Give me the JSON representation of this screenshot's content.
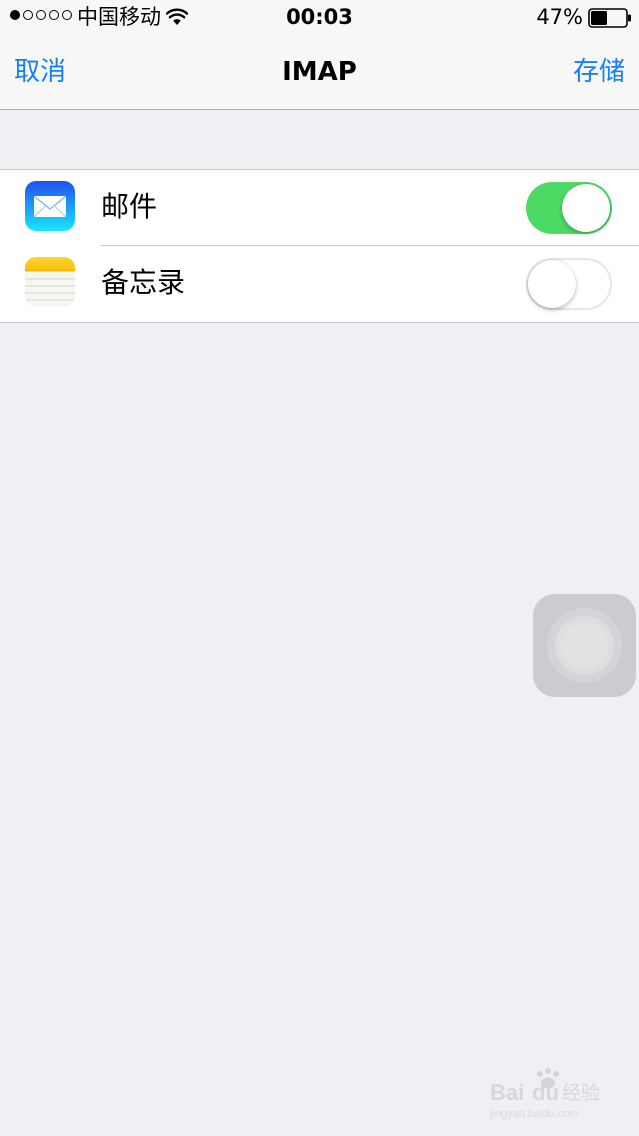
{
  "status_bar": {
    "carrier": "中国移动",
    "time": "00:03",
    "battery_percent": "47%",
    "battery_level": 0.47,
    "signal_bars_filled": 1,
    "signal_bars_total": 5
  },
  "nav": {
    "cancel_label": "取消",
    "title": "IMAP",
    "save_label": "存储"
  },
  "settings": {
    "items": [
      {
        "label": "邮件",
        "icon": "mail-app-icon",
        "enabled": true
      },
      {
        "label": "备忘录",
        "icon": "notes-app-icon",
        "enabled": false
      }
    ]
  },
  "watermark": {
    "text": "Baidu经验",
    "subtext": "jingyan.baidu.com"
  },
  "colors": {
    "accent": "#147efb",
    "toggle_on": "#4cd964",
    "background": "#efeff4"
  }
}
